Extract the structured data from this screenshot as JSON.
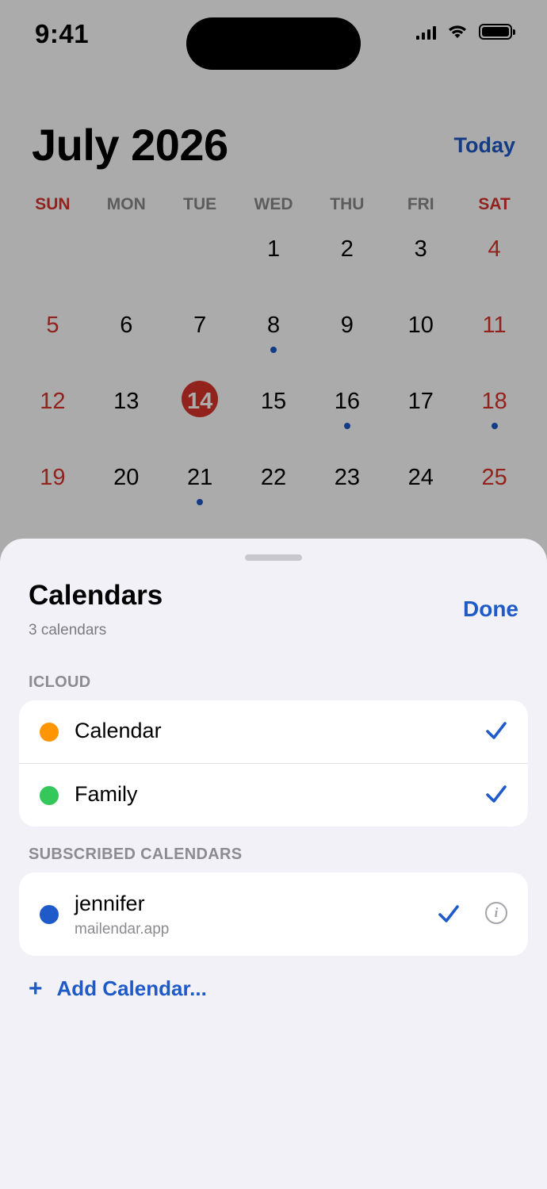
{
  "status_bar": {
    "time": "9:41"
  },
  "calendar": {
    "month_title": "July 2026",
    "today_label": "Today",
    "weekdays": [
      "SUN",
      "MON",
      "TUE",
      "WED",
      "THU",
      "FRI",
      "SAT"
    ],
    "weeks": [
      [
        {
          "day": ""
        },
        {
          "day": ""
        },
        {
          "day": ""
        },
        {
          "day": "1"
        },
        {
          "day": "2"
        },
        {
          "day": "3"
        },
        {
          "day": "4"
        }
      ],
      [
        {
          "day": "5"
        },
        {
          "day": "6"
        },
        {
          "day": "7"
        },
        {
          "day": "8",
          "event": true
        },
        {
          "day": "9"
        },
        {
          "day": "10"
        },
        {
          "day": "11"
        }
      ],
      [
        {
          "day": "12"
        },
        {
          "day": "13"
        },
        {
          "day": "14",
          "today": true
        },
        {
          "day": "15"
        },
        {
          "day": "16",
          "event": true
        },
        {
          "day": "17"
        },
        {
          "day": "18",
          "event": true
        }
      ],
      [
        {
          "day": "19"
        },
        {
          "day": "20"
        },
        {
          "day": "21",
          "event": true
        },
        {
          "day": "22"
        },
        {
          "day": "23"
        },
        {
          "day": "24"
        },
        {
          "day": "25"
        }
      ]
    ],
    "colors": {
      "weekend": "#d9332b",
      "accent": "#1e5ac8",
      "today_circle": "#d9332b"
    }
  },
  "sheet": {
    "title": "Calendars",
    "subtitle": "3 calendars",
    "done_label": "Done",
    "sections": [
      {
        "label": "ICLOUD",
        "items": [
          {
            "name": "Calendar",
            "color": "#ff9500",
            "checked": true
          },
          {
            "name": "Family",
            "color": "#34c759",
            "checked": true
          }
        ]
      },
      {
        "label": "SUBSCRIBED CALENDARS",
        "items": [
          {
            "name": "jennifer",
            "subtitle": "mailendar.app",
            "color": "#1e5ac8",
            "checked": true,
            "info_icon": "info-icon"
          }
        ]
      }
    ],
    "add_calendar": {
      "icon": "+",
      "label": "Add Calendar..."
    }
  }
}
